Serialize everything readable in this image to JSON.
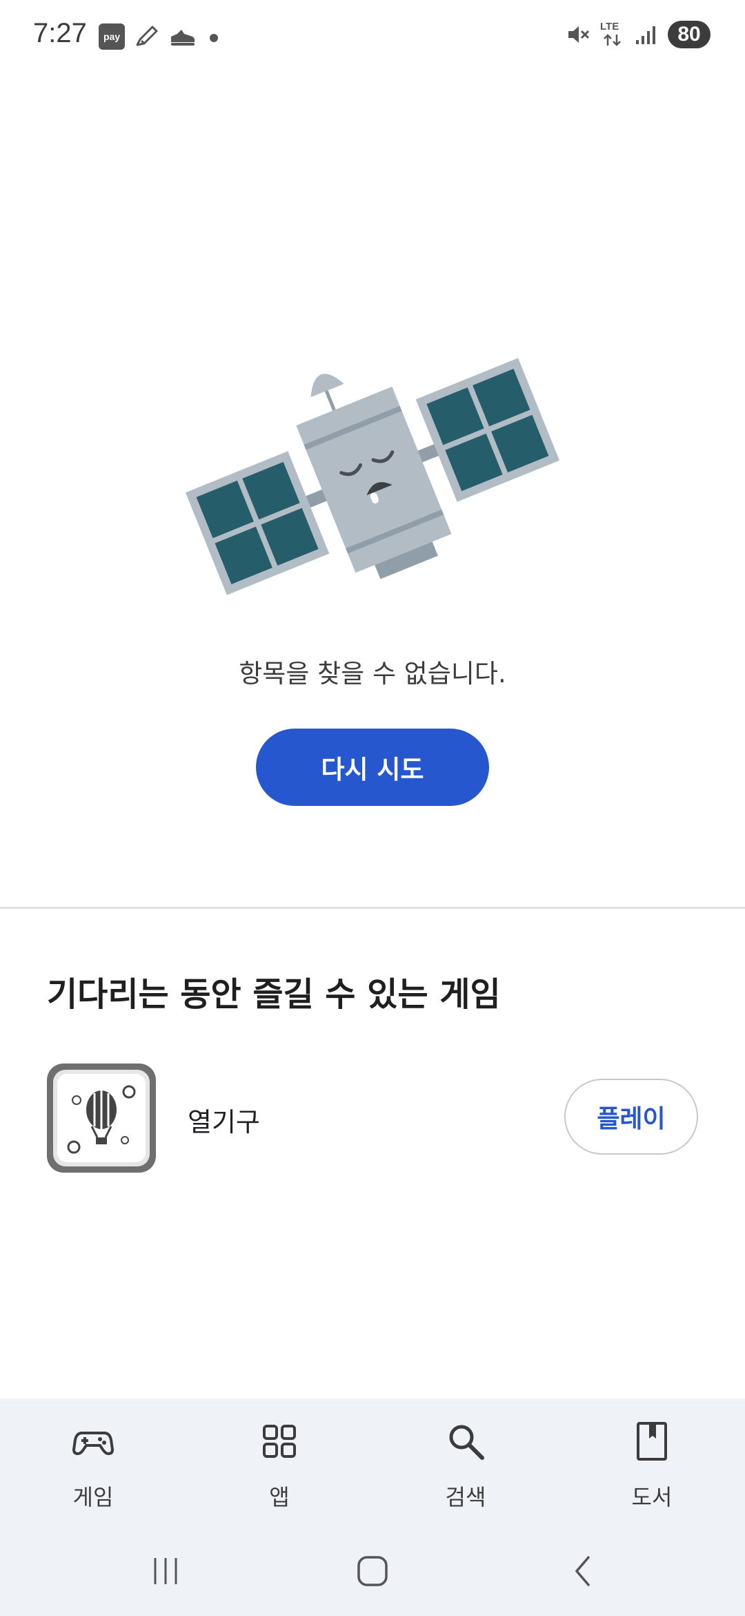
{
  "status_bar": {
    "time": "7:27",
    "pay_badge": "pay",
    "network": "LTE",
    "battery": "80",
    "icons": [
      "pay-icon",
      "pen-icon",
      "shoe-icon",
      "dot-icon",
      "mute-icon",
      "lte-icon",
      "signal-icon",
      "battery-icon"
    ]
  },
  "empty_state": {
    "illustration": "sleeping-satellite",
    "message": "항목을 찾을 수 없습니다.",
    "retry_label": "다시 시도"
  },
  "games_section": {
    "title": "기다리는 동안 즐길 수 있는 게임",
    "games": [
      {
        "name": "열기구",
        "icon": "hot-air-balloon-icon",
        "play_label": "플레이"
      }
    ]
  },
  "bottom_nav": {
    "items": [
      {
        "label": "게임",
        "icon": "gamepad-icon"
      },
      {
        "label": "앱",
        "icon": "apps-grid-icon"
      },
      {
        "label": "검색",
        "icon": "search-icon"
      },
      {
        "label": "도서",
        "icon": "book-icon"
      }
    ]
  },
  "colors": {
    "primary": "#2757cf",
    "satellite_panel": "#255e6a",
    "satellite_body": "#b2bcc4",
    "nav_background": "#eff2f7"
  }
}
